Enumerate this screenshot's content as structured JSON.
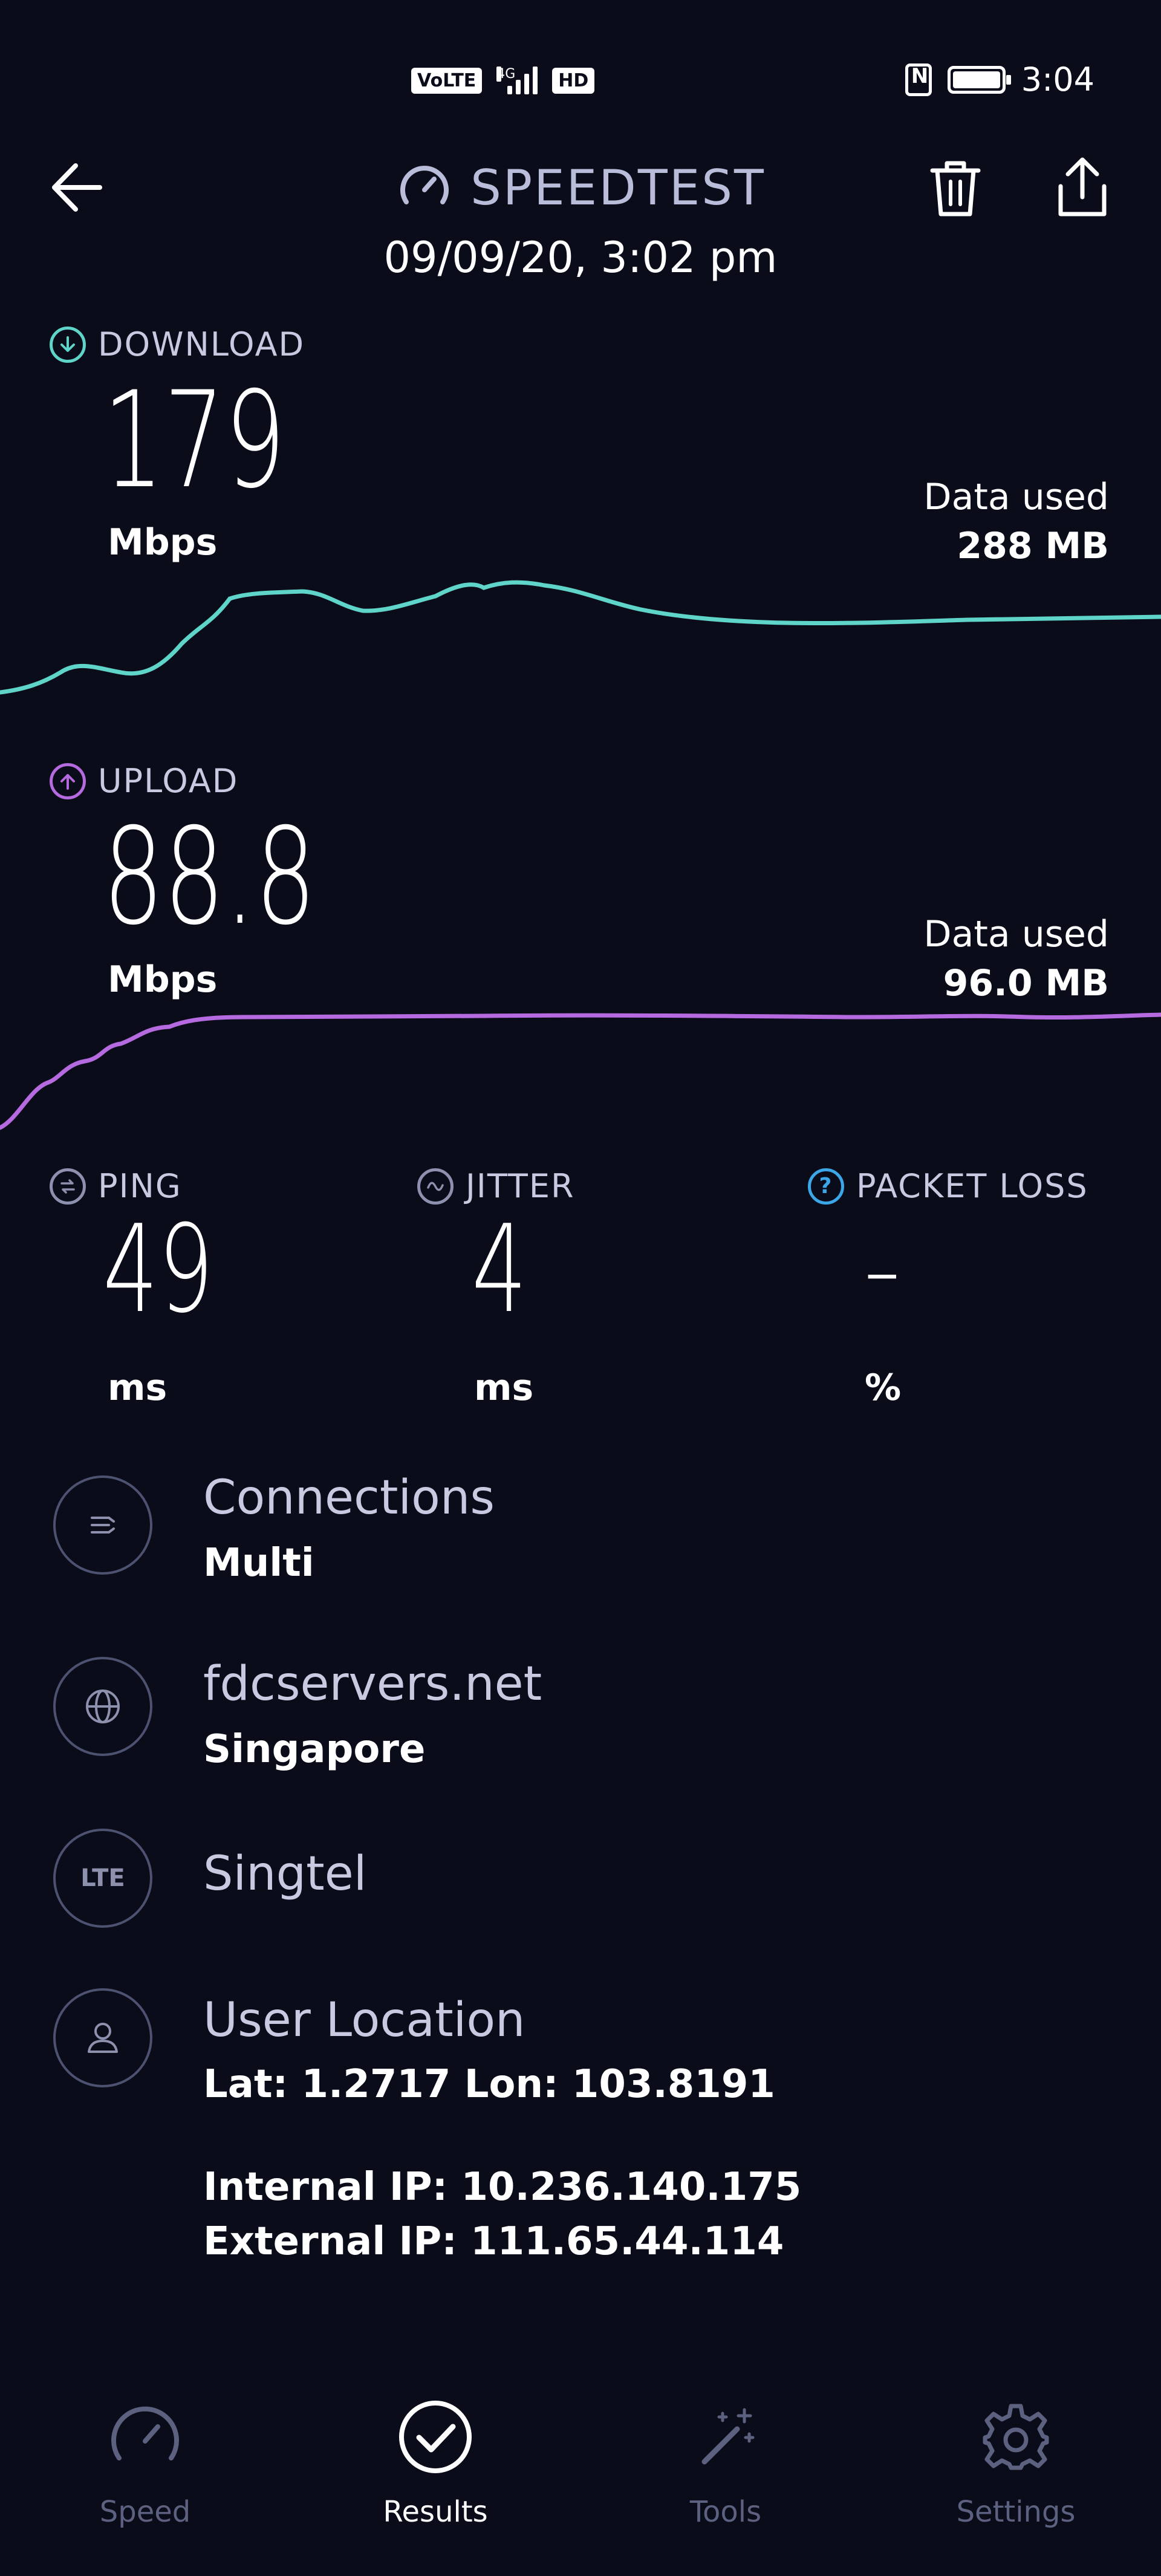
{
  "status_bar": {
    "carrier_badge": "VoLTE",
    "network": "4G",
    "hd_badge": "HD",
    "time": "3:04"
  },
  "header": {
    "title": "SPEEDTEST",
    "date": "09/09/20, 3:02 pm"
  },
  "download": {
    "label": "DOWNLOAD",
    "value": "179",
    "unit": "Mbps",
    "data_used_label": "Data used",
    "data_used_value": "288 MB",
    "color": "#5fd4c9"
  },
  "upload": {
    "label": "UPLOAD",
    "value": "88.8",
    "unit": "Mbps",
    "data_used_label": "Data used",
    "data_used_value": "96.0 MB",
    "color": "#b56bdf"
  },
  "ping": {
    "label": "PING",
    "value": "49",
    "unit": "ms"
  },
  "jitter": {
    "label": "JITTER",
    "value": "4",
    "unit": "ms"
  },
  "packet_loss": {
    "label": "PACKET LOSS",
    "value": "–",
    "unit": "%",
    "color": "#3ba6e8"
  },
  "connections": {
    "title": "Connections",
    "value": "Multi",
    "icon": "connections-icon"
  },
  "server": {
    "title": "fdcservers.net",
    "value": "Singapore",
    "icon": "globe-icon"
  },
  "provider": {
    "title": "Singtel",
    "icon_label": "LTE",
    "icon": "lte-icon"
  },
  "location": {
    "title": "User Location",
    "coords": "Lat: 1.2717 Lon: 103.8191",
    "internal_ip": "Internal IP: 10.236.140.175",
    "external_ip": "External IP: 111.65.44.114",
    "icon": "user-icon"
  },
  "nav": {
    "items": [
      {
        "label": "Speed",
        "icon": "speedometer-icon",
        "active": false
      },
      {
        "label": "Results",
        "icon": "check-circle-icon",
        "active": true
      },
      {
        "label": "Tools",
        "icon": "magic-wand-icon",
        "active": false
      },
      {
        "label": "Settings",
        "icon": "gear-icon",
        "active": false
      }
    ]
  }
}
